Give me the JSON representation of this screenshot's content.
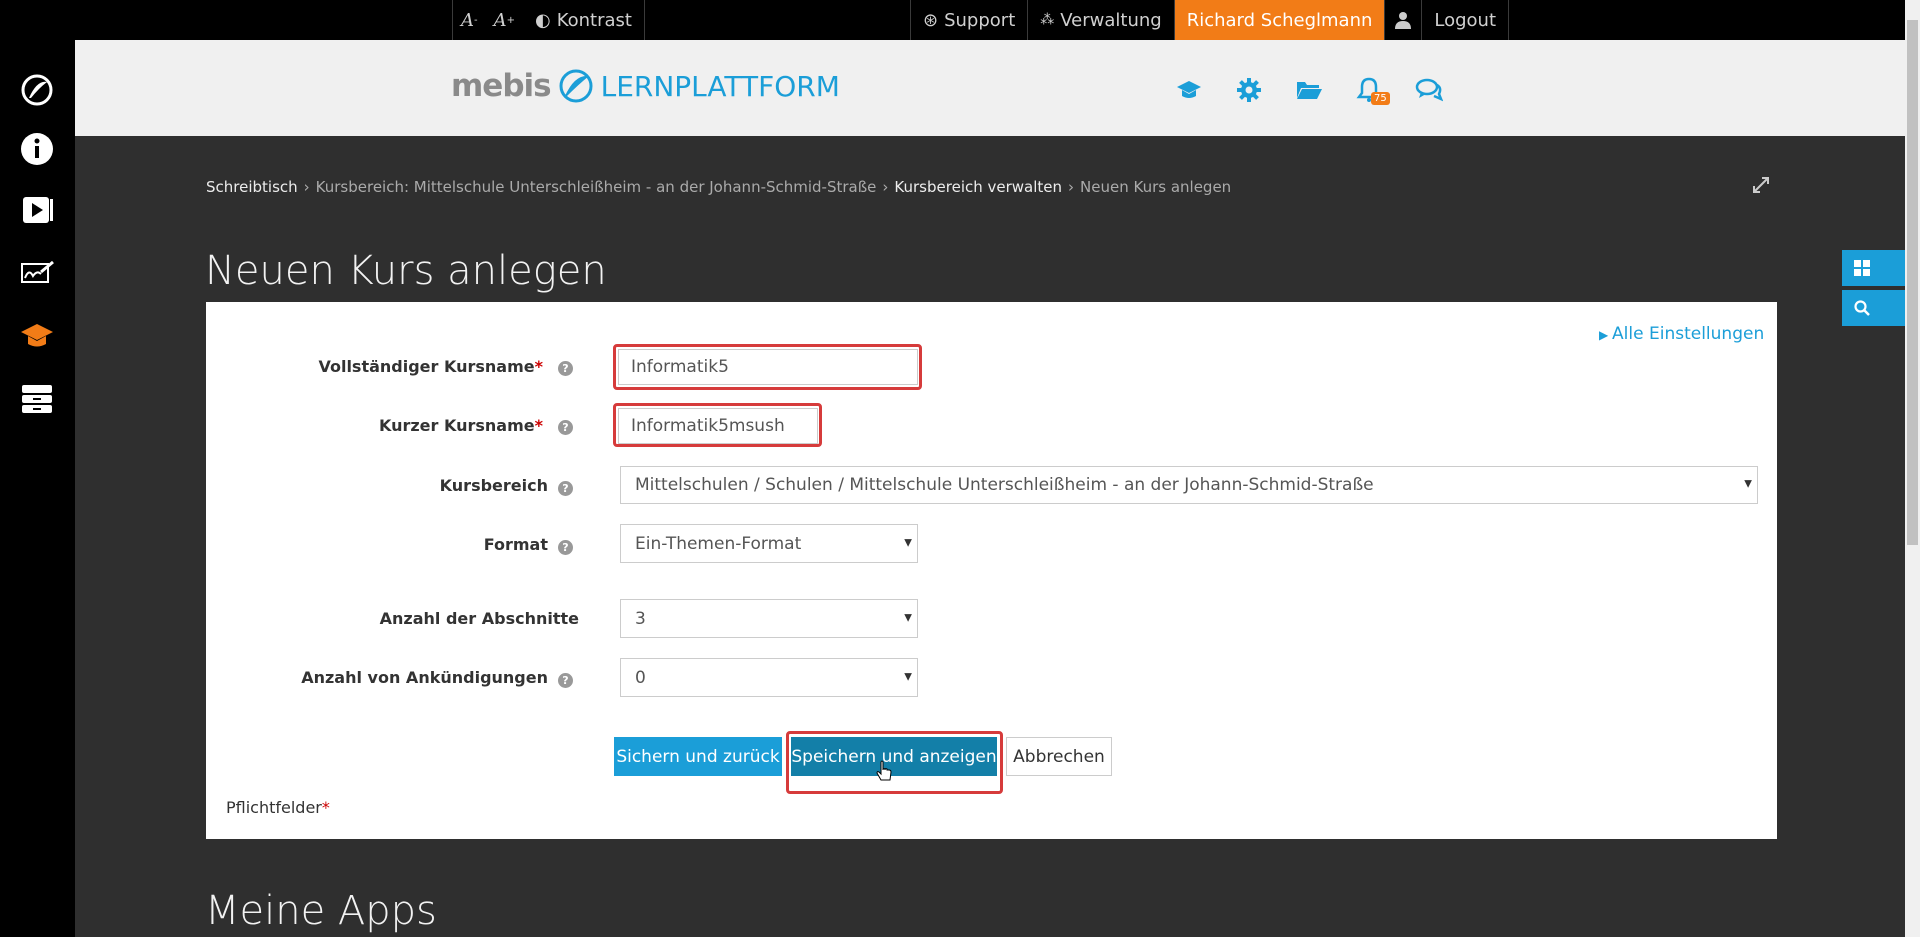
{
  "topbar": {
    "font_decrease_icon": "font-decrease-icon",
    "font_increase_icon": "font-increase-icon",
    "contrast_label": "Kontrast",
    "support_label": "Support",
    "verwaltung_label": "Verwaltung",
    "user_name": "Richard Scheglmann",
    "logout_label": "Logout"
  },
  "header": {
    "logo_mebis": "mebis",
    "logo_platform": "LERNPLATTFORM",
    "notification_count": "75"
  },
  "breadcrumb": {
    "items": [
      "Schreibtisch",
      "Kursbereich: Mittelschule Unterschleißheim - an der Johann-Schmid-Straße",
      "Kursbereich verwalten",
      "Neuen Kurs anlegen"
    ],
    "separator": "›"
  },
  "page_title": "Neuen Kurs anlegen",
  "form": {
    "alle_einstellungen": "Alle Einstellungen",
    "fullname_label": "Vollständiger Kursname",
    "fullname_value": "Informatik5",
    "shortname_label": "Kurzer Kursname",
    "shortname_value": "Informatik5msush",
    "category_label": "Kursbereich",
    "category_value": "Mittelschulen / Schulen / Mittelschule Unterschleißheim - an der Johann-Schmid-Straße",
    "format_label": "Format",
    "format_value": "Ein-Themen-Format",
    "sections_label": "Anzahl der Abschnitte",
    "sections_value": "3",
    "news_label": "Anzahl von Ankündigungen",
    "news_value": "0",
    "required_mark": "*",
    "help_mark": "?",
    "btn_save_return": "Sichern und zurück",
    "btn_save_display": "Speichern und anzeigen",
    "btn_cancel": "Abbrechen",
    "required_note": "Pflichtfelder"
  },
  "apps_title": "Meine Apps",
  "colors": {
    "accent": "#1b9ed8",
    "user": "#f27c17",
    "highlight": "#d63b3b"
  }
}
